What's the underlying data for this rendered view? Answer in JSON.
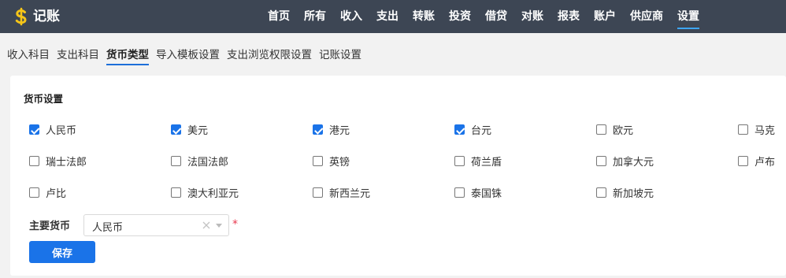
{
  "app": {
    "title": "记账"
  },
  "nav": {
    "items": [
      {
        "label": "首页",
        "active": false
      },
      {
        "label": "所有",
        "active": false
      },
      {
        "label": "收入",
        "active": false
      },
      {
        "label": "支出",
        "active": false
      },
      {
        "label": "转账",
        "active": false
      },
      {
        "label": "投资",
        "active": false
      },
      {
        "label": "借贷",
        "active": false
      },
      {
        "label": "对账",
        "active": false
      },
      {
        "label": "报表",
        "active": false
      },
      {
        "label": "账户",
        "active": false
      },
      {
        "label": "供应商",
        "active": false
      },
      {
        "label": "设置",
        "active": true
      }
    ]
  },
  "subtabs": {
    "items": [
      {
        "label": "收入科目",
        "active": false
      },
      {
        "label": "支出科目",
        "active": false
      },
      {
        "label": "货币类型",
        "active": true
      },
      {
        "label": "导入模板设置",
        "active": false
      },
      {
        "label": "支出浏览权限设置",
        "active": false
      },
      {
        "label": "记账设置",
        "active": false
      }
    ]
  },
  "currency_settings": {
    "title": "货币设置",
    "currencies": [
      {
        "label": "人民币",
        "checked": true
      },
      {
        "label": "美元",
        "checked": true
      },
      {
        "label": "港元",
        "checked": true
      },
      {
        "label": "台元",
        "checked": true
      },
      {
        "label": "欧元",
        "checked": false
      },
      {
        "label": "马克",
        "checked": false
      },
      {
        "label": "瑞士法郎",
        "checked": false
      },
      {
        "label": "法国法郎",
        "checked": false
      },
      {
        "label": "英镑",
        "checked": false
      },
      {
        "label": "荷兰盾",
        "checked": false
      },
      {
        "label": "加拿大元",
        "checked": false
      },
      {
        "label": "卢布",
        "checked": false
      },
      {
        "label": "卢比",
        "checked": false
      },
      {
        "label": "澳大利亚元",
        "checked": false
      },
      {
        "label": "新西兰元",
        "checked": false
      },
      {
        "label": "泰国铢",
        "checked": false
      },
      {
        "label": "新加坡元",
        "checked": false
      }
    ],
    "primary_label": "主要货币",
    "primary_value": "人民币",
    "required_mark": "*",
    "save_label": "保存"
  },
  "colors": {
    "topbar": "#3d4654",
    "accent": "#1a73e8",
    "logo": "#f5c518",
    "required": "#e8384f"
  },
  "icons": {
    "logo": "dollar-icon",
    "clear": "clear-icon",
    "dropdown": "chevron-down-icon"
  }
}
